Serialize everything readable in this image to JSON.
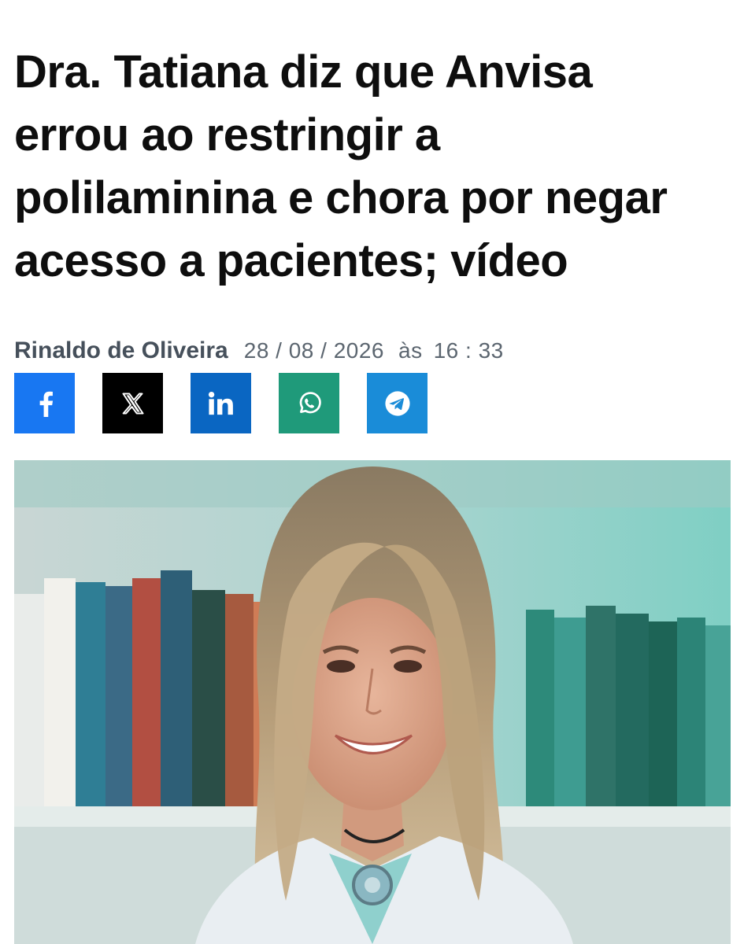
{
  "article": {
    "headline_lines": [
      "Dra. Tatiana diz que Anvisa",
      "errou ao restringir a",
      "polilaminina e chora por negar",
      "acesso a pacientes; vídeo"
    ],
    "author": "Rinaldo de Oliveira",
    "date": "28 / 08 / 2026",
    "time_connector": "às",
    "time": "16 : 33"
  },
  "share_buttons": [
    {
      "network": "facebook",
      "icon": "facebook-icon",
      "color": "#1877f2"
    },
    {
      "network": "x",
      "icon": "x-icon",
      "color": "#000000"
    },
    {
      "network": "linkedin",
      "icon": "linkedin-icon",
      "color": "#0a66c2"
    },
    {
      "network": "whatsapp",
      "icon": "whatsapp-icon",
      "color": "#1f9a7a"
    },
    {
      "network": "telegram",
      "icon": "telegram-icon",
      "color": "#1a8cd8"
    }
  ],
  "hero_image": {
    "subject": "woman-in-white-coat-portrait",
    "background": "bookshelf"
  }
}
